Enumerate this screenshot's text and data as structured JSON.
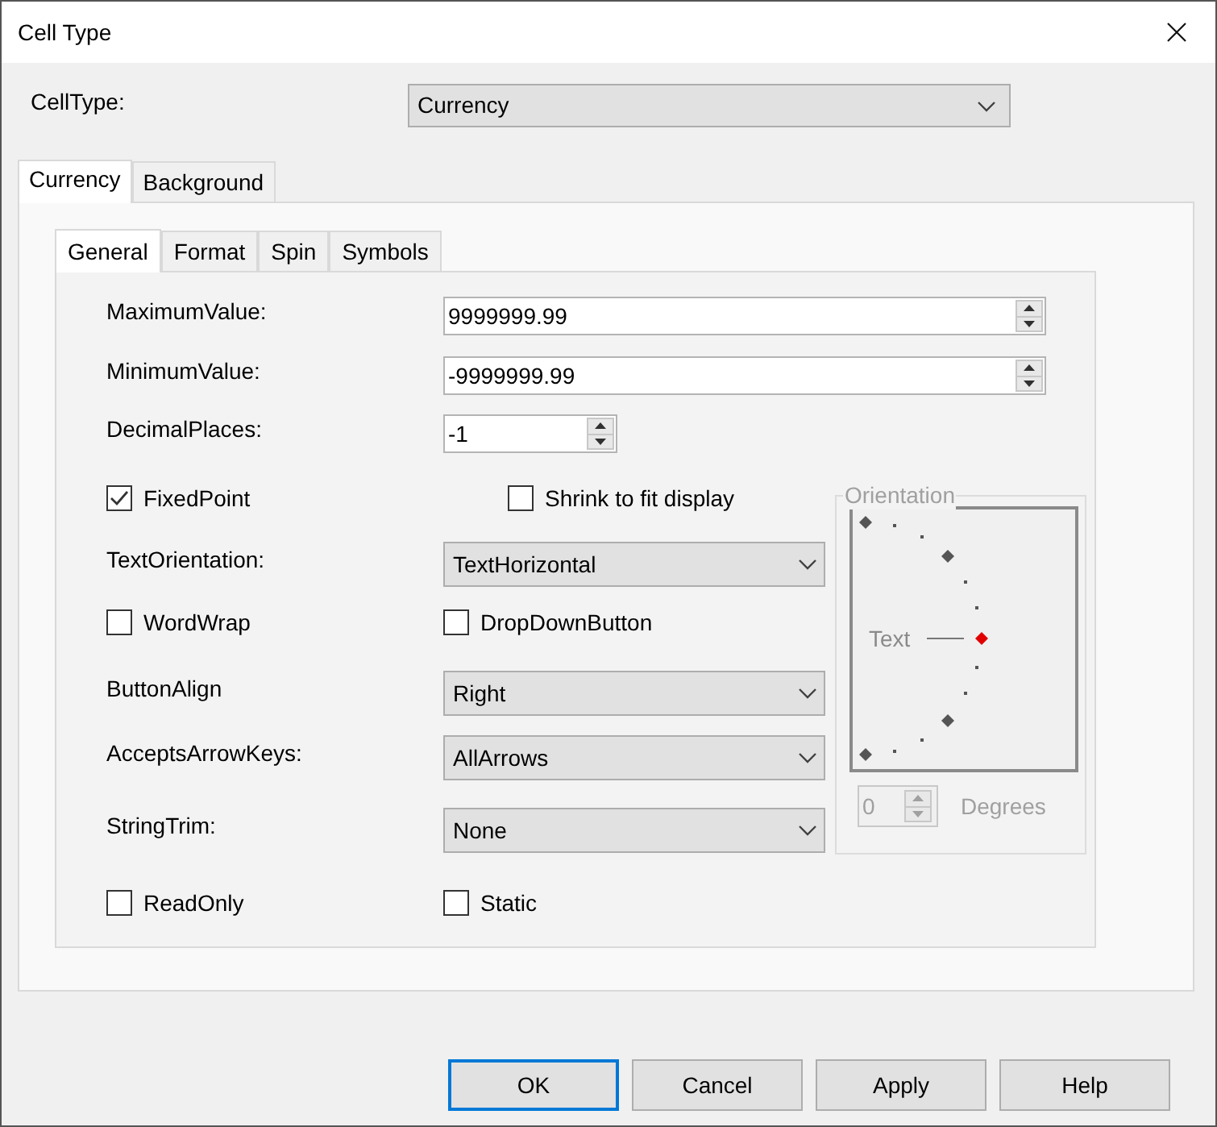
{
  "window": {
    "title": "Cell Type"
  },
  "cell_type": {
    "label": "CellType:",
    "value": "Currency"
  },
  "tabs": [
    {
      "label": "Currency",
      "selected": true
    },
    {
      "label": "Background",
      "selected": false
    }
  ],
  "subtabs": [
    {
      "label": "General",
      "selected": true
    },
    {
      "label": "Format",
      "selected": false
    },
    {
      "label": "Spin",
      "selected": false
    },
    {
      "label": "Symbols",
      "selected": false
    }
  ],
  "range_fields": [
    {
      "label": "MaximumValue:",
      "value": "9999999.99"
    },
    {
      "label": "MinimumValue:",
      "value": "-9999999.99"
    }
  ],
  "decimal_places": {
    "label": "DecimalPlaces:",
    "value": "-1"
  },
  "rows": [
    {
      "kind": "staggered",
      "checks": [
        {
          "label": "FixedPoint",
          "checked": true
        },
        {
          "label": "Shrink to fit display",
          "checked": false
        }
      ]
    },
    {
      "kind": "select",
      "label": "TextOrientation:",
      "value": "TextHorizontal"
    },
    {
      "kind": "checks",
      "checks": [
        {
          "label": "WordWrap",
          "checked": false
        },
        {
          "label": "DropDownButton",
          "checked": false
        }
      ]
    },
    {
      "kind": "select",
      "label": "ButtonAlign",
      "value": "Right"
    },
    {
      "kind": "select",
      "label": "AcceptsArrowKeys:",
      "value": "AllArrows"
    },
    {
      "kind": "select",
      "label": "StringTrim:",
      "value": "None"
    },
    {
      "kind": "checks",
      "checks": [
        {
          "label": "ReadOnly",
          "checked": false
        },
        {
          "label": "Static",
          "checked": false
        }
      ]
    }
  ],
  "orientation": {
    "title": "Orientation",
    "disabled": true,
    "dial_label": "Text",
    "degrees": "0",
    "unit": "Degrees"
  },
  "buttons": [
    {
      "label": "OK",
      "default": true
    },
    {
      "label": "Cancel",
      "default": false
    },
    {
      "label": "Apply",
      "default": false
    },
    {
      "label": "Help",
      "default": false
    }
  ]
}
